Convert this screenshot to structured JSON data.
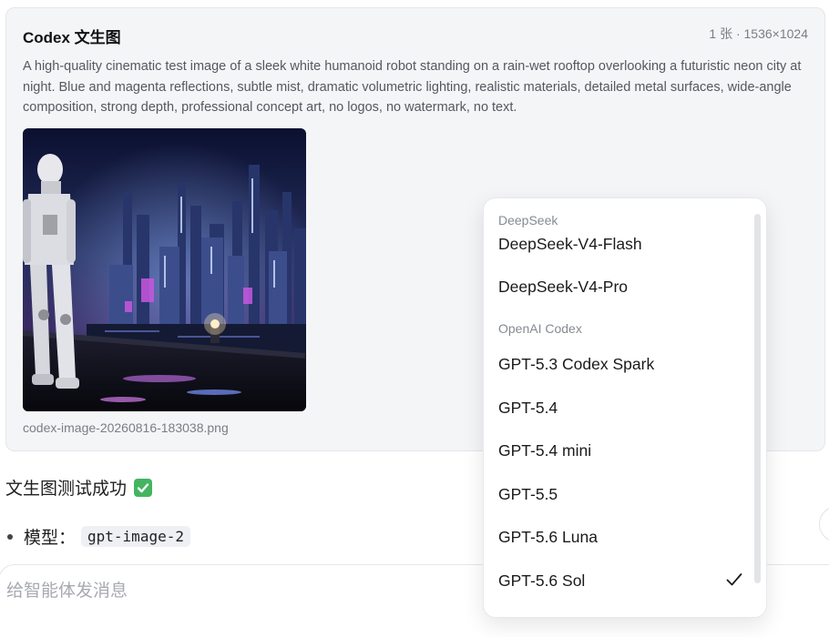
{
  "card": {
    "title": "Codex 文生图",
    "meta": "1 张 · 1536×1024",
    "prompt": "A high-quality cinematic test image of a sleek white humanoid robot standing on a rain-wet rooftop overlooking a futuristic neon city at night. Blue and magenta reflections, subtle mist, dramatic volumetric lighting, realistic materials, detailed metal surfaces, wide-angle composition, strong depth, professional concept art, no logos, no watermark, no text.",
    "filename": "codex-image-20260816-183038.png"
  },
  "message": {
    "result": "文生图测试成功",
    "model_label": "模型：",
    "model_value": "gpt-image-2"
  },
  "composer": {
    "placeholder": "给智能体发消息"
  },
  "model_menu": {
    "groups": [
      {
        "label": "DeepSeek",
        "items": [
          "DeepSeek-V4-Flash",
          "DeepSeek-V4-Pro"
        ]
      },
      {
        "label": "OpenAI Codex",
        "items": [
          "GPT-5.3 Codex Spark",
          "GPT-5.4",
          "GPT-5.4 mini",
          "GPT-5.5",
          "GPT-5.6 Luna",
          "GPT-5.6 Sol"
        ]
      }
    ],
    "selected": "GPT-5.6 Sol"
  },
  "colors": {
    "success": "#43b561",
    "muted_text": "#7a7d83",
    "card_bg": "#f4f5f7"
  }
}
